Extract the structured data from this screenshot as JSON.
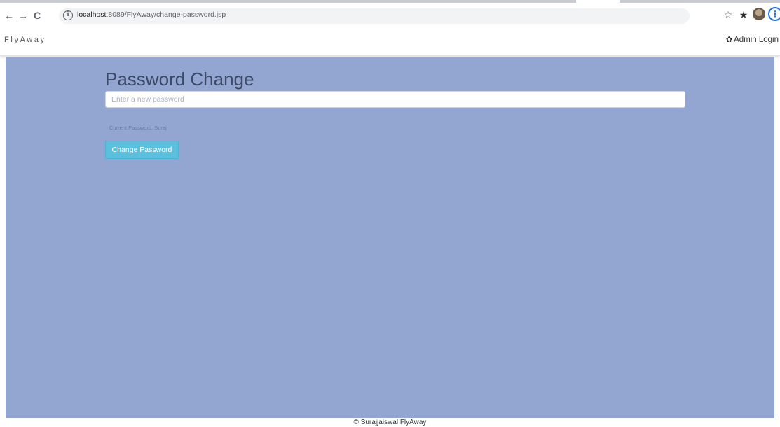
{
  "browser": {
    "url_host": "localhost",
    "url_path": ":8089/FlyAway/change-password.jsp",
    "back_icon": "←",
    "forward_icon": "→",
    "reload_icon": "C",
    "info_icon": "i",
    "star_icon": "☆",
    "extension_icon": "★",
    "menu_icon": "⋮"
  },
  "navbar": {
    "brand": "FlyAway",
    "admin_login_icon": "✿",
    "admin_login": "Admin Login"
  },
  "main": {
    "background": "#93a6d2",
    "title": "Password Change",
    "new_password_placeholder": "Enter a new password",
    "current_password_text": "Current Password: Suraj",
    "change_button": "Change Password"
  },
  "footer": {
    "text": "© Surajjaiswal FlyAway"
  }
}
